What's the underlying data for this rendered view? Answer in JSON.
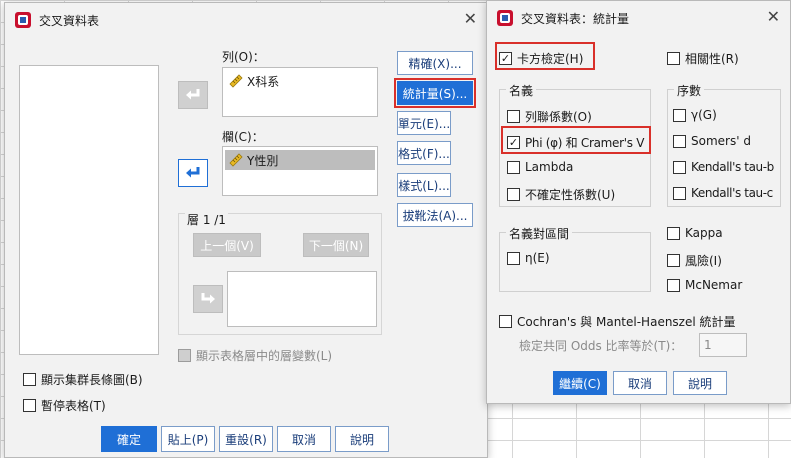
{
  "main_dialog": {
    "title": "交叉資料表",
    "rows_label": "列(O)：",
    "rows_items": [
      "X科系"
    ],
    "columns_label": "欄(C)：",
    "columns_items": [
      "Y性別"
    ],
    "layer_label": "層 1 /1",
    "prev_button": "上一個(V)",
    "next_button": "下一個(N)",
    "side_buttons": [
      "精確(X)...",
      "統計量(S)...",
      "單元(E)...",
      "格式(F)...",
      "樣式(L)...",
      "拔靴法(A)..."
    ],
    "display_layer_label": "顯示表格層中的層變數(L)",
    "clustered_bar_label": "顯示集群長條圖(B)",
    "suppress_tables_label": "暫停表格(T)",
    "bottom_buttons": [
      "確定",
      "貼上(P)",
      "重設(R)",
      "取消",
      "說明"
    ]
  },
  "stats_dialog": {
    "title": "交叉資料表：統計量",
    "chi_square": {
      "label": "卡方檢定(H)",
      "checked": true
    },
    "correlations": {
      "label": "相關性(R)",
      "checked": false
    },
    "nominal": {
      "title": "名義",
      "items": [
        {
          "label": "列聯係數(O)",
          "checked": false
        },
        {
          "label": "Phi (φ) 和 Cramer's V",
          "checked": true
        },
        {
          "label": "Lambda",
          "checked": false
        },
        {
          "label": "不確定性係數(U)",
          "checked": false
        }
      ]
    },
    "ordinal": {
      "title": "序數",
      "items": [
        {
          "label": "γ(G)",
          "checked": false
        },
        {
          "label": "Somers' d",
          "checked": false
        },
        {
          "label": "Kendall's tau-b",
          "checked": false
        },
        {
          "label": "Kendall's tau-c",
          "checked": false
        }
      ]
    },
    "nominal_interval": {
      "title": "名義對區間",
      "items": [
        {
          "label": "η(E)",
          "checked": false
        }
      ]
    },
    "kappa": {
      "label": "Kappa",
      "checked": false
    },
    "risk": {
      "label": "風險(I)",
      "checked": false
    },
    "mcnemar": {
      "label": "McNemar",
      "checked": false
    },
    "cmh": {
      "label": "Cochran's 與 Mantel-Haenszel 統計量",
      "checked": false
    },
    "odds_label": "檢定共同 Odds 比率等於(T)：",
    "odds_value": "1",
    "buttons": [
      "繼續(C)",
      "取消",
      "說明"
    ]
  }
}
